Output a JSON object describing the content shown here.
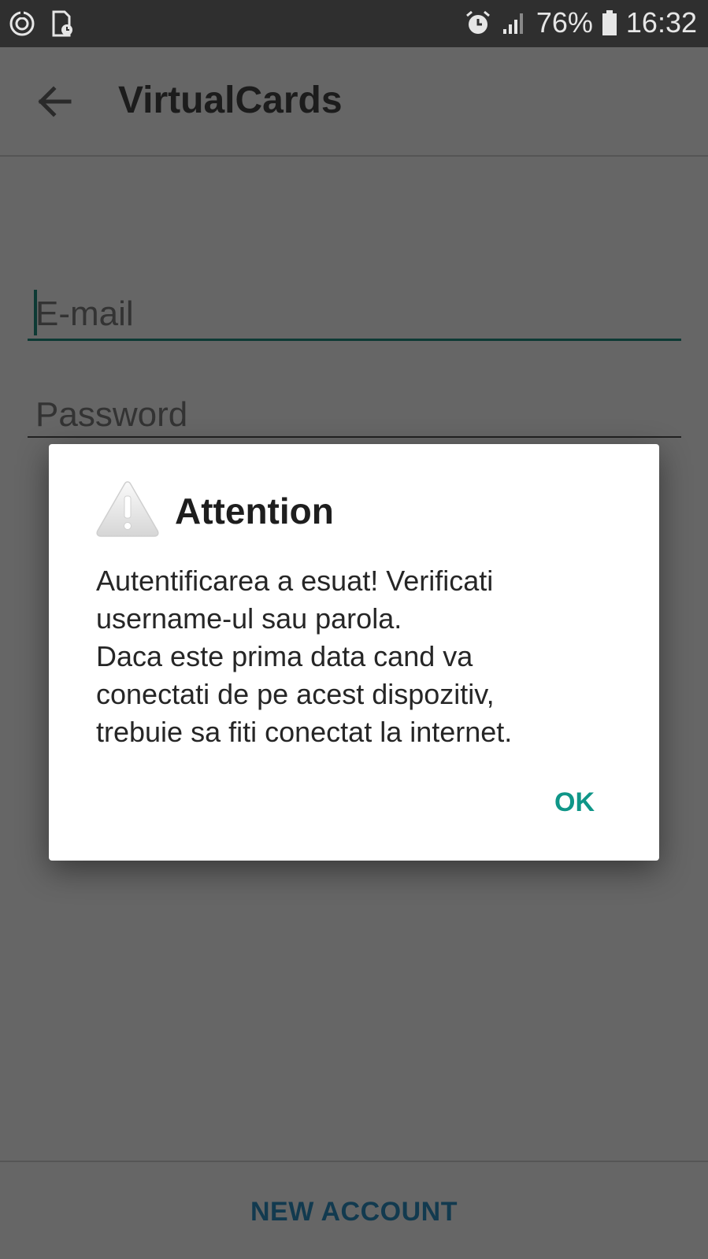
{
  "status_bar": {
    "battery": "76%",
    "time": "16:32",
    "icons": [
      "sync-icon",
      "screenshot-icon",
      "alarm-icon",
      "signal-icon",
      "battery-icon"
    ]
  },
  "app_bar": {
    "title": "VirtualCards",
    "back_icon": "arrow-back-icon"
  },
  "form": {
    "email_placeholder": "E-mail",
    "password_placeholder": "Password"
  },
  "footer": {
    "new_account_label": "NEW ACCOUNT"
  },
  "dialog": {
    "title": "Attention",
    "icon": "warning-icon",
    "message": "Autentificarea a esuat! Verificati\nusername-ul sau parola.\nDaca este prima data cand va\nconectati de pe acest dispozitiv,\ntrebuie sa fiti conectat la internet.",
    "ok_label": "OK"
  },
  "colors": {
    "accent": "#0f9688",
    "dim_background": "#666666",
    "status_bar": "#2f2f2f"
  }
}
